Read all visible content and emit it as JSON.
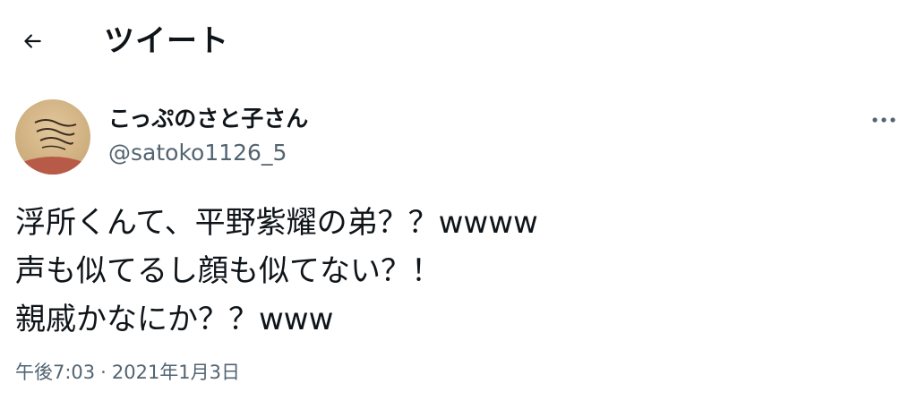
{
  "header": {
    "back_icon": "arrow-left-icon",
    "title": "ツイート"
  },
  "author": {
    "avatar_icon": "profile-avatar",
    "display_name": "こっぷのさと子さん",
    "handle": "@satoko1126_5"
  },
  "more_icon": "more-horizontal-icon",
  "tweet": {
    "lines": [
      "浮所くんて、平野紫耀の弟？？wwww",
      "声も似てるし顔も似てない？！",
      "親戚かなにか？？www"
    ]
  },
  "meta": {
    "time": "午後7:03",
    "separator": "·",
    "date": "2021年1月3日"
  },
  "colors": {
    "text": "#0f1419",
    "secondary_text": "#536471",
    "background": "#ffffff"
  }
}
